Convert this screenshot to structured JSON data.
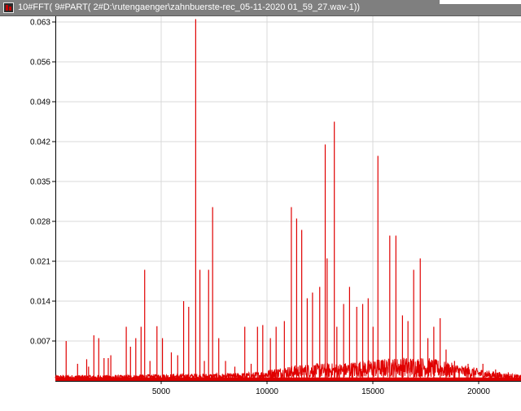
{
  "window": {
    "title": "10#FFT( 9#PART( 2#D:\\rutengaenger\\zahnbuerste-rec_05-11-2020 01_59_27.wav-1))",
    "icon": "app-icon"
  },
  "colors": {
    "series": "#e00000",
    "grid": "#d9d9d9",
    "axis": "#000000",
    "background": "#ffffff",
    "titlebar": "#7f7f7f"
  },
  "chart_data": {
    "type": "line",
    "title": "",
    "xlabel": "",
    "ylabel": "",
    "xlim": [
      0,
      22000
    ],
    "ylim": [
      0,
      0.064
    ],
    "grid": true,
    "legend": "none",
    "x_ticks": [
      5000,
      10000,
      15000,
      20000
    ],
    "y_ticks": [
      0.007,
      0.014,
      0.021,
      0.028,
      0.035,
      0.042,
      0.049,
      0.056,
      0.063
    ],
    "series": [
      {
        "name": "",
        "color": "#e00000",
        "noise_floor": [
          [
            0,
            0.0008
          ],
          [
            3000,
            0.0008
          ],
          [
            6000,
            0.001
          ],
          [
            8000,
            0.001
          ],
          [
            9500,
            0.0012
          ],
          [
            10500,
            0.0018
          ],
          [
            11500,
            0.0022
          ],
          [
            12500,
            0.0024
          ],
          [
            13500,
            0.0024
          ],
          [
            14500,
            0.0028
          ],
          [
            15500,
            0.003
          ],
          [
            16500,
            0.0032
          ],
          [
            17500,
            0.0032
          ],
          [
            18500,
            0.0026
          ],
          [
            19500,
            0.002
          ],
          [
            20500,
            0.0014
          ],
          [
            21500,
            0.001
          ],
          [
            22000,
            0.0008
          ]
        ],
        "peaks": [
          [
            510,
            0.007
          ],
          [
            1050,
            0.003
          ],
          [
            1480,
            0.0038
          ],
          [
            1570,
            0.0025
          ],
          [
            1820,
            0.008
          ],
          [
            2050,
            0.0075
          ],
          [
            2300,
            0.004
          ],
          [
            2500,
            0.004
          ],
          [
            2620,
            0.0045
          ],
          [
            3350,
            0.0095
          ],
          [
            3550,
            0.006
          ],
          [
            3800,
            0.0075
          ],
          [
            4050,
            0.0095
          ],
          [
            4220,
            0.0195
          ],
          [
            4470,
            0.0035
          ],
          [
            4800,
            0.0096
          ],
          [
            5060,
            0.0075
          ],
          [
            5480,
            0.005
          ],
          [
            5780,
            0.0045
          ],
          [
            6060,
            0.014
          ],
          [
            6300,
            0.013
          ],
          [
            6630,
            0.0635
          ],
          [
            6830,
            0.0195
          ],
          [
            7040,
            0.0035
          ],
          [
            7240,
            0.0195
          ],
          [
            7430,
            0.0305
          ],
          [
            7720,
            0.0075
          ],
          [
            8040,
            0.0035
          ],
          [
            8480,
            0.0025
          ],
          [
            8950,
            0.0095
          ],
          [
            9250,
            0.003
          ],
          [
            9550,
            0.0095
          ],
          [
            9800,
            0.0098
          ],
          [
            10160,
            0.0075
          ],
          [
            10430,
            0.0095
          ],
          [
            10820,
            0.0105
          ],
          [
            11150,
            0.0305
          ],
          [
            11400,
            0.0285
          ],
          [
            11640,
            0.0265
          ],
          [
            11900,
            0.0145
          ],
          [
            12150,
            0.0155
          ],
          [
            12490,
            0.0165
          ],
          [
            12750,
            0.0415
          ],
          [
            12840,
            0.0215
          ],
          [
            13180,
            0.0455
          ],
          [
            13300,
            0.0095
          ],
          [
            13620,
            0.0135
          ],
          [
            13900,
            0.0165
          ],
          [
            14240,
            0.013
          ],
          [
            14520,
            0.0135
          ],
          [
            14780,
            0.0145
          ],
          [
            15010,
            0.0095
          ],
          [
            15240,
            0.0395
          ],
          [
            15500,
            0.0035
          ],
          [
            15800,
            0.0255
          ],
          [
            16090,
            0.0255
          ],
          [
            16400,
            0.0115
          ],
          [
            16660,
            0.0105
          ],
          [
            16930,
            0.0195
          ],
          [
            17240,
            0.0215
          ],
          [
            17600,
            0.0075
          ],
          [
            17880,
            0.0095
          ],
          [
            18180,
            0.011
          ],
          [
            18460,
            0.0055
          ],
          [
            18860,
            0.0035
          ],
          [
            19500,
            0.003
          ],
          [
            20200,
            0.003
          ],
          [
            20800,
            0.002
          ],
          [
            21400,
            0.0015
          ]
        ]
      }
    ]
  }
}
